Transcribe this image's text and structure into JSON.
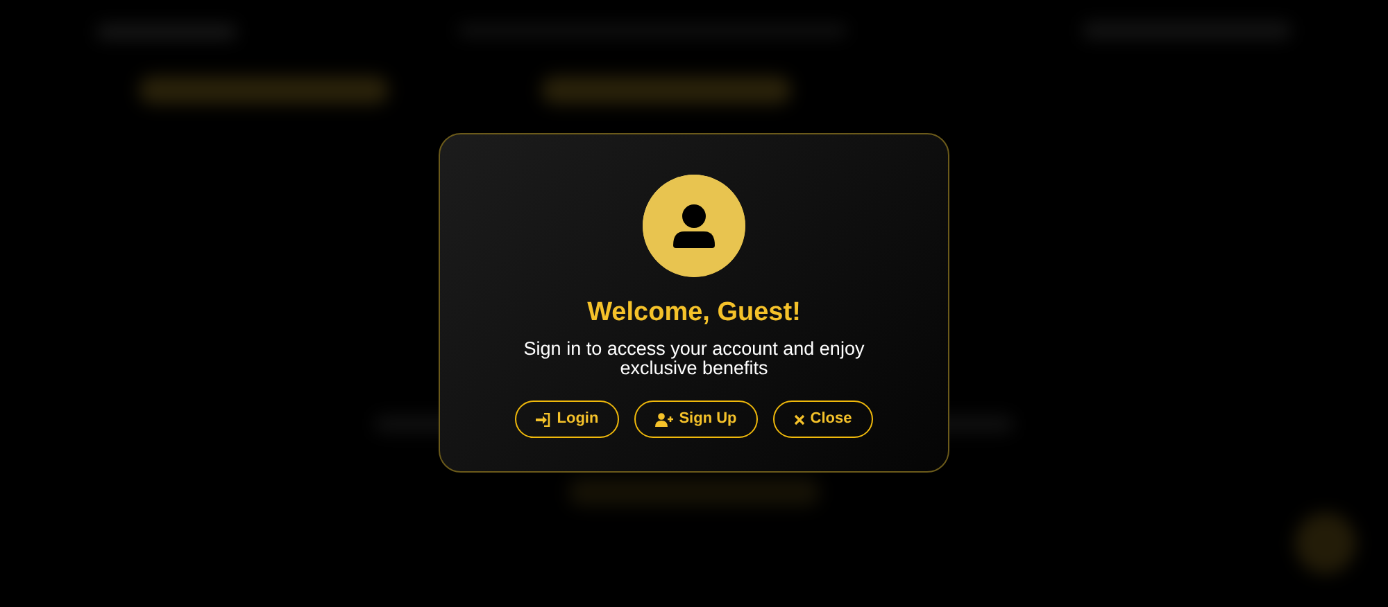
{
  "modal": {
    "title": "Welcome, Guest!",
    "message": "Sign in to access your account and enjoy exclusive benefits",
    "buttons": [
      {
        "kind": "login",
        "label": "Login"
      },
      {
        "kind": "signup",
        "label": "Sign Up"
      },
      {
        "kind": "close",
        "label": "Close"
      }
    ]
  }
}
